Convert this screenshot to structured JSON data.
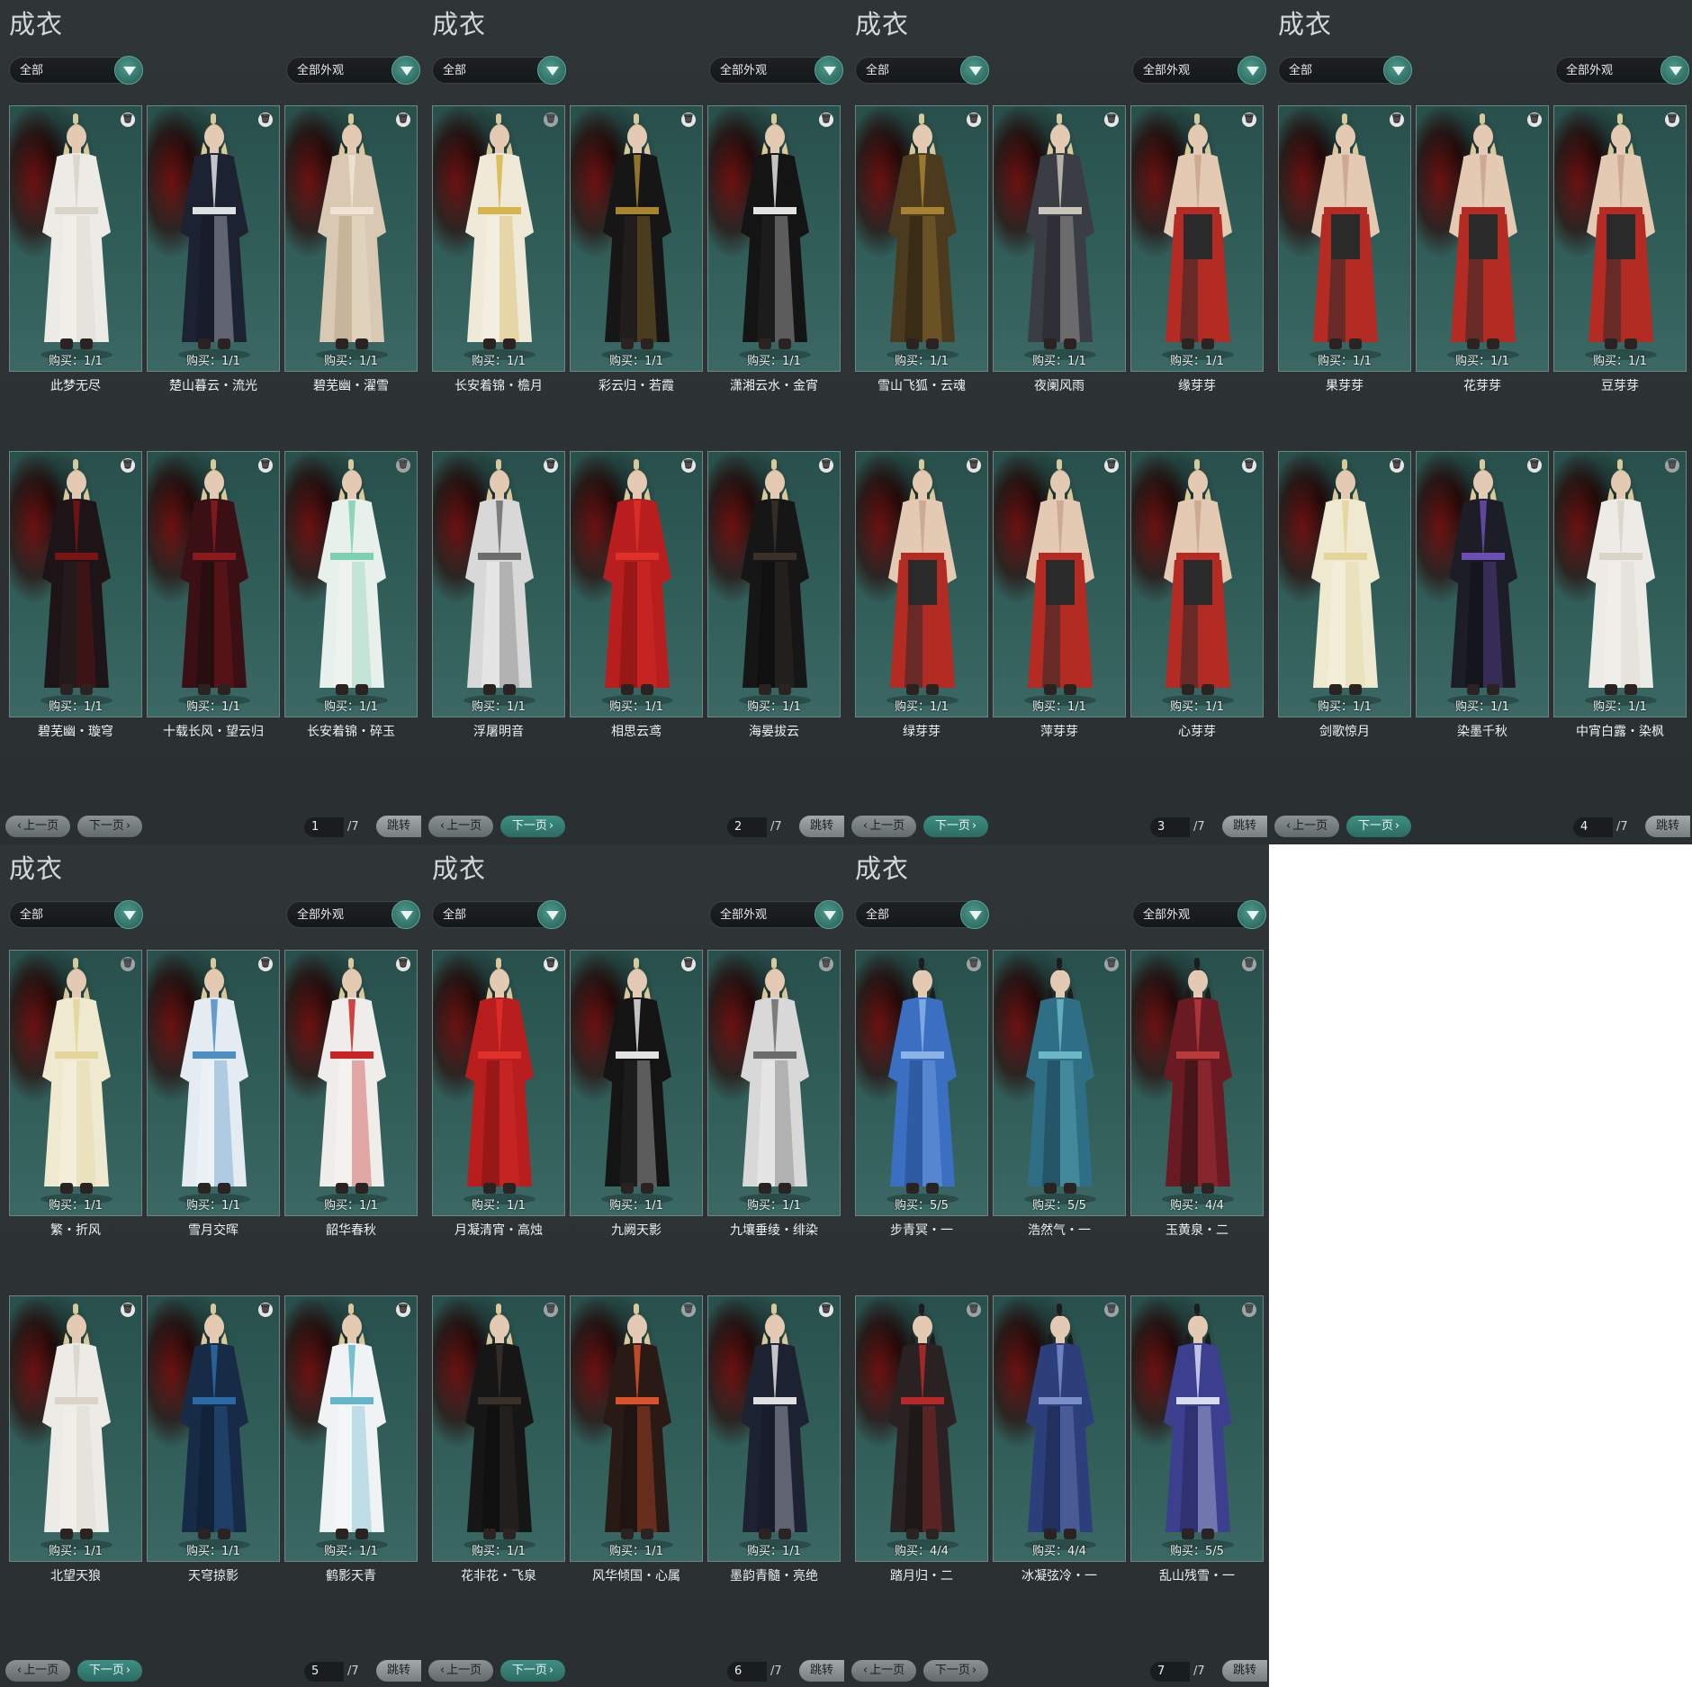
{
  "colors": {
    "panel_bg": "#2f3436",
    "accent_teal": "#3f8f84",
    "card_bg": "#2f5b56",
    "text_light": "#f0f2f2"
  },
  "panels": [
    {
      "title": "成衣",
      "filter_left": "全部",
      "filter_right": "全部外观",
      "prev_label": "上一页",
      "next_label": "下一页",
      "page": "1",
      "total": "/7",
      "jump_label": "跳转",
      "items": [
        {
          "name": "此梦无尽",
          "buy": "购买：1/1",
          "outfit": "white"
        },
        {
          "name": "楚山暮云・流光",
          "buy": "购买：1/1",
          "outfit": "navy"
        },
        {
          "name": "碧芜幽・濯雪",
          "buy": "购买：1/1",
          "outfit": "beige"
        },
        {
          "name": "碧芜幽・璇穹",
          "buy": "购买：1/1",
          "outfit": "black-red"
        },
        {
          "name": "十载长风・望云归",
          "buy": "购买：1/1",
          "outfit": "crimson"
        },
        {
          "name": "长安着锦・碎玉",
          "buy": "购买：1/1",
          "outfit": "mint"
        }
      ]
    },
    {
      "title": "成衣",
      "filter_left": "全部",
      "filter_right": "全部外观",
      "prev_label": "上一页",
      "next_label": "下一页",
      "page": "2",
      "total": "/7",
      "jump_label": "跳转",
      "items": [
        {
          "name": "长安着锦・檐月",
          "buy": "购买：1/1",
          "outfit": "gold"
        },
        {
          "name": "彩云归・若霞",
          "buy": "购买：1/1",
          "outfit": "black-gold"
        },
        {
          "name": "潇湘云水・金宵",
          "buy": "购买：1/1",
          "outfit": "black-white"
        },
        {
          "name": "浮屠明音",
          "buy": "购买：1/1",
          "outfit": "grey"
        },
        {
          "name": "相思云鸢",
          "buy": "购买：1/1",
          "outfit": "red"
        },
        {
          "name": "海晏拔云",
          "buy": "购买：1/1",
          "outfit": "black"
        }
      ]
    },
    {
      "title": "成衣",
      "filter_left": "全部",
      "filter_right": "全部外观",
      "prev_label": "上一页",
      "next_label": "下一页",
      "page": "3",
      "total": "/7",
      "jump_label": "跳转",
      "items": [
        {
          "name": "雪山飞狐・云魂",
          "buy": "购买：1/1",
          "outfit": "brown"
        },
        {
          "name": "夜阑风雨",
          "buy": "购买：1/1",
          "outfit": "darkgrey"
        },
        {
          "name": "缘芽芽",
          "buy": "购买：1/1",
          "outfit": "bare"
        },
        {
          "name": "绿芽芽",
          "buy": "购买：1/1",
          "outfit": "bare"
        },
        {
          "name": "萍芽芽",
          "buy": "购买：1/1",
          "outfit": "bare"
        },
        {
          "name": "心芽芽",
          "buy": "购买：1/1",
          "outfit": "bare"
        }
      ]
    },
    {
      "title": "成衣",
      "filter_left": "全部",
      "filter_right": "全部外观",
      "prev_label": "上一页",
      "next_label": "下一页",
      "page": "4",
      "total": "/7",
      "jump_label": "跳转",
      "items": [
        {
          "name": "果芽芽",
          "buy": "购买：1/1",
          "outfit": "bare"
        },
        {
          "name": "花芽芽",
          "buy": "购买：1/1",
          "outfit": "bare"
        },
        {
          "name": "豆芽芽",
          "buy": "购买：1/1",
          "outfit": "bare"
        },
        {
          "name": "剑歌惊月",
          "buy": "购买：1/1",
          "outfit": "cream"
        },
        {
          "name": "染墨千秋",
          "buy": "购买：1/1",
          "outfit": "purple"
        },
        {
          "name": "中宵白露・染枫",
          "buy": "购买：1/1",
          "outfit": "white"
        }
      ]
    },
    {
      "title": "成衣",
      "filter_left": "全部",
      "filter_right": "全部外观",
      "prev_label": "上一页",
      "next_label": "下一页",
      "page": "5",
      "total": "/7",
      "jump_label": "跳转",
      "items": [
        {
          "name": "繁・折风",
          "buy": "购买：1/1",
          "outfit": "cream"
        },
        {
          "name": "雪月交晖",
          "buy": "购买：1/1",
          "outfit": "skyblue"
        },
        {
          "name": "韶华春秋",
          "buy": "购买：1/1",
          "outfit": "white-red"
        },
        {
          "name": "北望天狼",
          "buy": "购买：1/1",
          "outfit": "white"
        },
        {
          "name": "天穹掠影",
          "buy": "购买：1/1",
          "outfit": "blue"
        },
        {
          "name": "鹤影天青",
          "buy": "购买：1/1",
          "outfit": "white-cyan"
        }
      ]
    },
    {
      "title": "成衣",
      "filter_left": "全部",
      "filter_right": "全部外观",
      "prev_label": "上一页",
      "next_label": "下一页",
      "page": "6",
      "total": "/7",
      "jump_label": "跳转",
      "items": [
        {
          "name": "月凝清宵・高烛",
          "buy": "购买：1/1",
          "outfit": "red"
        },
        {
          "name": "九阙天影",
          "buy": "购买：1/1",
          "outfit": "black-white"
        },
        {
          "name": "九壤垂绫・绯染",
          "buy": "购买：1/1",
          "outfit": "grey"
        },
        {
          "name": "花非花・飞泉",
          "buy": "购买：1/1",
          "outfit": "black"
        },
        {
          "name": "风华倾国・心属",
          "buy": "购买：1/1",
          "outfit": "orange"
        },
        {
          "name": "墨韵青髓・亮绝",
          "buy": "购买：1/1",
          "outfit": "navy"
        }
      ]
    },
    {
      "title": "成衣",
      "filter_left": "全部",
      "filter_right": "全部外观",
      "prev_label": "上一页",
      "next_label": "下一页",
      "page": "7",
      "total": "/7",
      "jump_label": "跳转",
      "items": [
        {
          "name": "步青冥・一",
          "buy": "购买：5/5",
          "outfit": "armor-blue"
        },
        {
          "name": "浩然气・一",
          "buy": "购买：5/5",
          "outfit": "armor-teal"
        },
        {
          "name": "玉黄泉・二",
          "buy": "购买：4/4",
          "outfit": "armor-red"
        },
        {
          "name": "踏月归・二",
          "buy": "购买：4/4",
          "outfit": "armor-black"
        },
        {
          "name": "冰凝弦冷・一",
          "buy": "购买：4/4",
          "outfit": "armor-navy"
        },
        {
          "name": "乱山残雪・一",
          "buy": "购买：5/5",
          "outfit": "armor-purple"
        }
      ]
    }
  ]
}
